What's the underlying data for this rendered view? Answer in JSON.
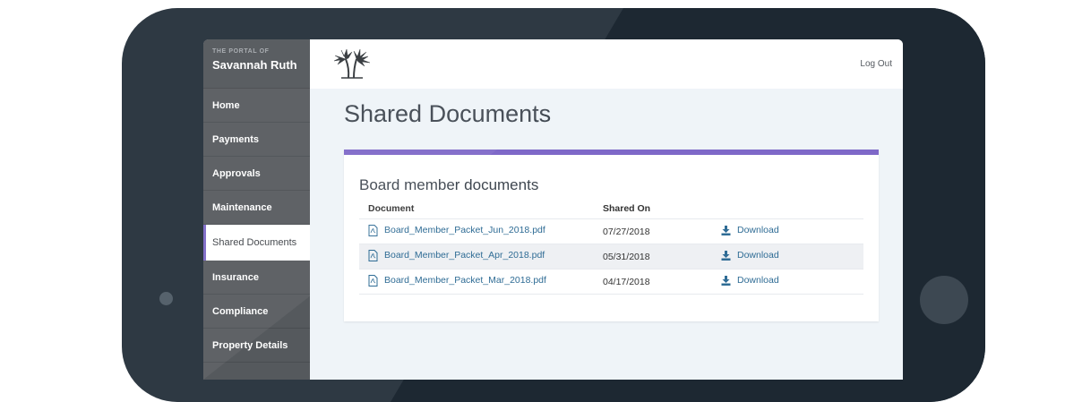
{
  "brand": {
    "portal_label": "THE PORTAL OF",
    "name": "Savannah Ruth"
  },
  "nav": {
    "items": [
      {
        "label": "Home"
      },
      {
        "label": "Payments"
      },
      {
        "label": "Approvals"
      },
      {
        "label": "Maintenance"
      },
      {
        "label": "Shared Documents",
        "active": true
      },
      {
        "label": "Insurance"
      },
      {
        "label": "Compliance"
      },
      {
        "label": "Property Details"
      }
    ]
  },
  "header": {
    "logout_label": "Log Out",
    "logo_icon": "palm-trees-logo-icon"
  },
  "page": {
    "title": "Shared Documents"
  },
  "card": {
    "title": "Board member documents",
    "columns": {
      "document": "Document",
      "shared_on": "Shared On",
      "action": ""
    },
    "rows": [
      {
        "file": "Board_Member_Packet_Jun_2018.pdf",
        "date": "07/27/2018",
        "action": "Download"
      },
      {
        "file": "Board_Member_Packet_Apr_2018.pdf",
        "date": "05/31/2018",
        "action": "Download"
      },
      {
        "file": "Board_Member_Packet_Mar_2018.pdf",
        "date": "04/17/2018",
        "action": "Download"
      }
    ]
  },
  "colors": {
    "accent": "#7e68c8",
    "link": "#2f6c95",
    "sidebar": "#55595d",
    "device": "#2e3943"
  }
}
